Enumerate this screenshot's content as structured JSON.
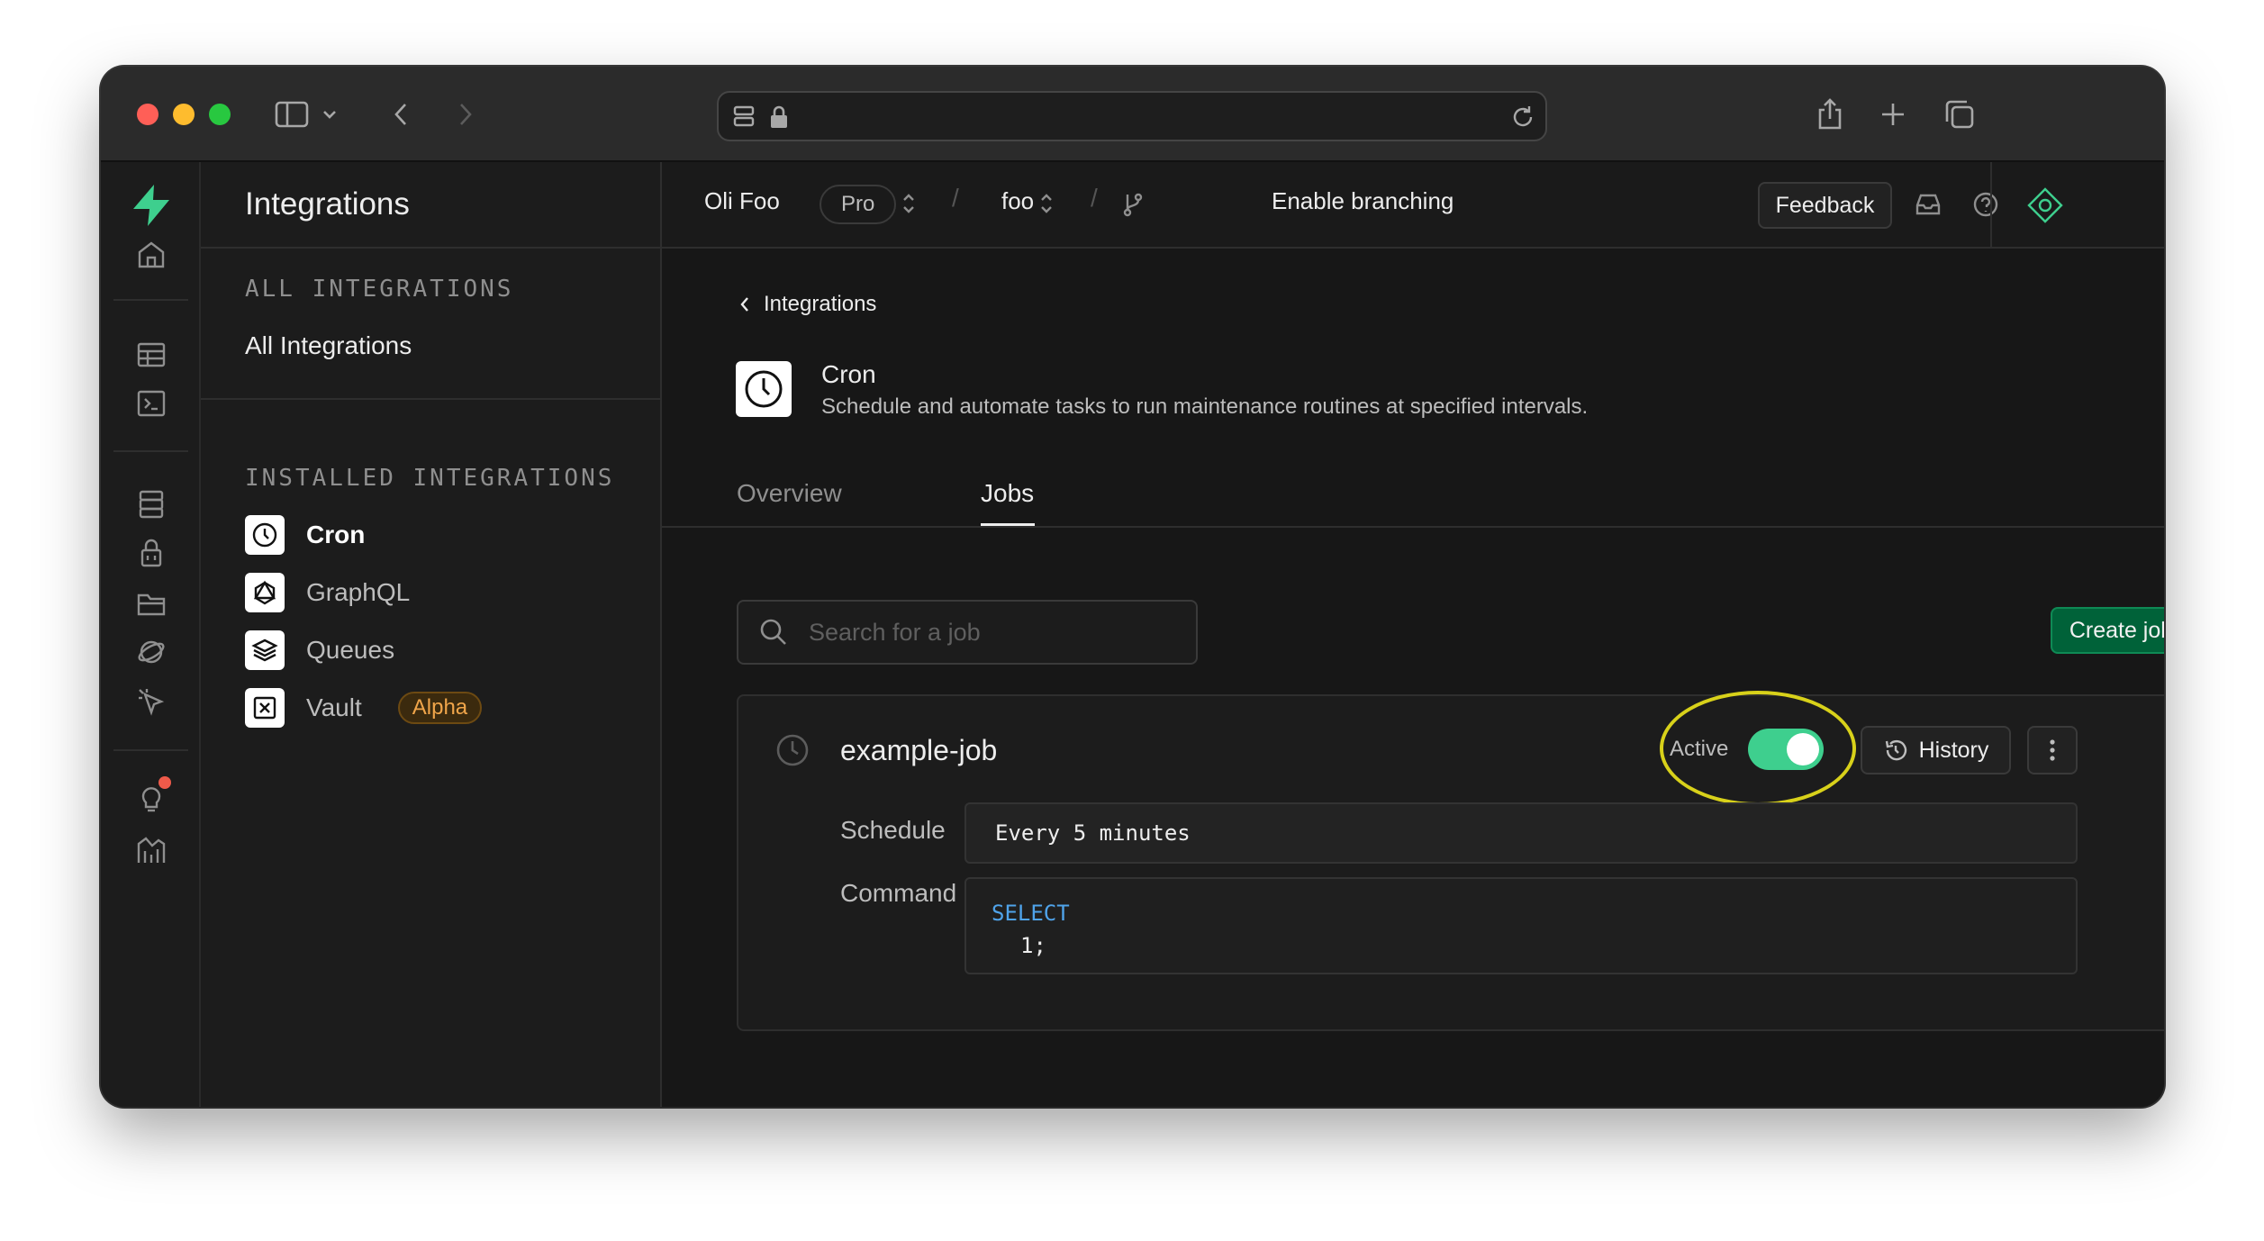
{
  "browser": {
    "url": ""
  },
  "sidebar": {
    "title": "Integrations",
    "all_section_label": "ALL INTEGRATIONS",
    "all_link": "All Integrations",
    "installed_section_label": "INSTALLED INTEGRATIONS",
    "installed": [
      {
        "label": "Cron",
        "icon": "clock-icon",
        "active": true
      },
      {
        "label": "GraphQL",
        "icon": "graphql-icon",
        "active": false
      },
      {
        "label": "Queues",
        "icon": "layers-icon",
        "active": false
      },
      {
        "label": "Vault",
        "icon": "vault-icon",
        "active": false,
        "badge": "Alpha"
      }
    ]
  },
  "topbar": {
    "org": "Oli Foo",
    "plan_badge": "Pro",
    "project": "foo",
    "branching": "Enable branching",
    "feedback": "Feedback"
  },
  "main": {
    "back_link": "Integrations",
    "integration_title": "Cron",
    "integration_description": "Schedule and automate tasks to run maintenance routines at specified intervals.",
    "tabs": [
      {
        "label": "Overview",
        "active": false
      },
      {
        "label": "Jobs",
        "active": true
      }
    ],
    "search_placeholder": "Search for a job",
    "create_button": "Create job",
    "job": {
      "name": "example-job",
      "status_label": "Active",
      "active": true,
      "history_button": "History",
      "schedule_label": "Schedule",
      "schedule_value": "Every 5 minutes",
      "command_label": "Command",
      "command_keyword": "SELECT",
      "command_rest": "1;"
    }
  },
  "colors": {
    "brand_green": "#3ecf8e",
    "create_button_bg": "#006239",
    "alpha_badge_text": "#f0a54a",
    "sql_keyword": "#4fa3ea",
    "annotation_ring": "#d8d11a"
  }
}
